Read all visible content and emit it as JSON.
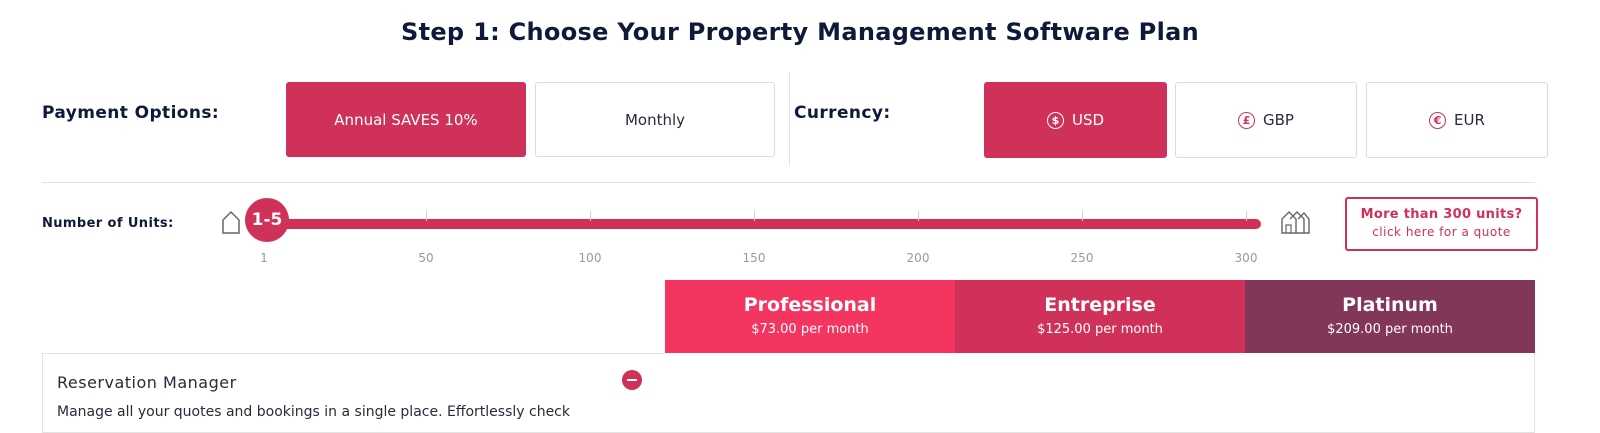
{
  "title": "Step 1: Choose Your Property Management Software Plan",
  "payment": {
    "label": "Payment Options:",
    "options": [
      "Annual SAVES 10%",
      "Monthly"
    ],
    "selected": "Annual SAVES 10%"
  },
  "currency": {
    "label": "Currency:",
    "options": [
      {
        "symbol": "$",
        "code": "USD"
      },
      {
        "symbol": "£",
        "code": "GBP"
      },
      {
        "symbol": "€",
        "code": "EUR"
      }
    ],
    "selected": "USD"
  },
  "units": {
    "label": "Number of Units:",
    "value_label": "1-5",
    "ticks": [
      "1",
      "50",
      "100",
      "150",
      "200",
      "250",
      "300"
    ],
    "min_icon": "house-icon",
    "max_icon": "buildings-icon"
  },
  "quote": {
    "line1": "More than 300 units?",
    "line2": "click here for a quote"
  },
  "plans": [
    {
      "name": "Professional",
      "price": "$73.00 per month",
      "color": "#f4355f"
    },
    {
      "name": "Entreprise",
      "price": "$125.00 per month",
      "color": "#cf3158"
    },
    {
      "name": "Platinum",
      "price": "$209.00 per month",
      "color": "#823659"
    }
  ],
  "features": [
    {
      "name": "Reservation Manager",
      "description": "Manage all your quotes and bookings in a single place. Effortlessly check"
    }
  ],
  "colors": {
    "accent": "#cf3158"
  }
}
